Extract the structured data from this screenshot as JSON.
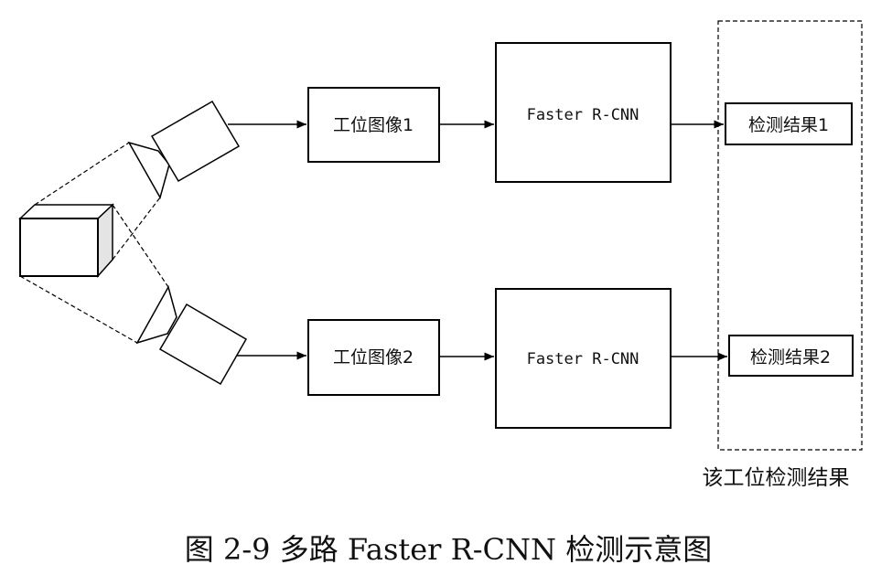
{
  "nodes": {
    "image1": "工位图像1",
    "image2": "工位图像2",
    "model1": "Faster R-CNN",
    "model2": "Faster R-CNN",
    "result1": "检测结果1",
    "result2": "检测结果2"
  },
  "group_label": "该工位检测结果",
  "caption": "图 2-9 多路 Faster R-CNN 检测示意图"
}
